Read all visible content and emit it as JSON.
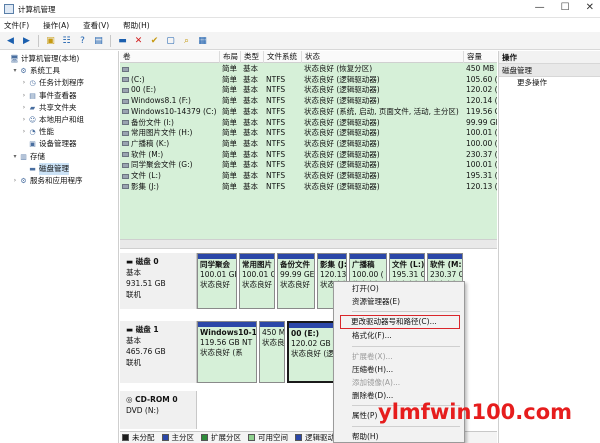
{
  "window": {
    "title": "计算机管理",
    "buttons": [
      "—",
      "☐",
      "✕"
    ]
  },
  "menu": [
    "文件(F)",
    "操作(A)",
    "查看(V)",
    "帮助(H)"
  ],
  "tree": [
    {
      "label": "计算机管理(本地)",
      "indent": 0,
      "expander": "",
      "icon": "computer-icon"
    },
    {
      "label": "系统工具",
      "indent": 1,
      "expander": "▾",
      "icon": "tools-icon"
    },
    {
      "label": "任务计划程序",
      "indent": 2,
      "expander": "›",
      "icon": "clock-icon"
    },
    {
      "label": "事件查看器",
      "indent": 2,
      "expander": "›",
      "icon": "event-icon"
    },
    {
      "label": "共享文件夹",
      "indent": 2,
      "expander": "›",
      "icon": "folder-icon"
    },
    {
      "label": "本地用户和组",
      "indent": 2,
      "expander": "›",
      "icon": "users-icon"
    },
    {
      "label": "性能",
      "indent": 2,
      "expander": "›",
      "icon": "performance-icon"
    },
    {
      "label": "设备管理器",
      "indent": 2,
      "expander": "",
      "icon": "device-icon"
    },
    {
      "label": "存储",
      "indent": 1,
      "expander": "▾",
      "icon": "storage-icon"
    },
    {
      "label": "磁盘管理",
      "indent": 2,
      "expander": "",
      "icon": "disk-icon",
      "selected": true
    },
    {
      "label": "服务和应用程序",
      "indent": 1,
      "expander": "›",
      "icon": "services-icon"
    }
  ],
  "table": {
    "headers": [
      "卷",
      "布局",
      "类型",
      "文件系统",
      "状态",
      "容量"
    ],
    "rows": [
      {
        "vol": "",
        "layout": "简单",
        "type": "基本",
        "fs": "",
        "status": "状态良好 (恢复分区)",
        "cap": "450 MB"
      },
      {
        "vol": "(C:)",
        "layout": "简单",
        "type": "基本",
        "fs": "NTFS",
        "status": "状态良好 (逻辑驱动器)",
        "cap": "105.60 ("
      },
      {
        "vol": "00 (E:)",
        "layout": "简单",
        "type": "基本",
        "fs": "NTFS",
        "status": "状态良好 (逻辑驱动器)",
        "cap": "120.02 ("
      },
      {
        "vol": "Windows8.1 (F:)",
        "layout": "简单",
        "type": "基本",
        "fs": "NTFS",
        "status": "状态良好 (逻辑驱动器)",
        "cap": "120.14 ("
      },
      {
        "vol": "Windows10-14379 (C:)",
        "layout": "简单",
        "type": "基本",
        "fs": "NTFS",
        "status": "状态良好 (系统, 启动, 页面文件, 活动, 主分区)",
        "cap": "119.56 G"
      },
      {
        "vol": "备份文件 (I:)",
        "layout": "简单",
        "type": "基本",
        "fs": "NTFS",
        "status": "状态良好 (逻辑驱动器)",
        "cap": "99.99 GB"
      },
      {
        "vol": "常用图片文件 (H:)",
        "layout": "简单",
        "type": "基本",
        "fs": "NTFS",
        "status": "状态良好 (逻辑驱动器)",
        "cap": "100.01 ("
      },
      {
        "vol": "广播稿 (K:)",
        "layout": "简单",
        "type": "基本",
        "fs": "NTFS",
        "status": "状态良好 (逻辑驱动器)",
        "cap": "100.00 ("
      },
      {
        "vol": "软件 (M:)",
        "layout": "简单",
        "type": "基本",
        "fs": "NTFS",
        "status": "状态良好 (逻辑驱动器)",
        "cap": "230.37 ("
      },
      {
        "vol": "同学聚会文件 (G:)",
        "layout": "简单",
        "type": "基本",
        "fs": "NTFS",
        "status": "状态良好 (逻辑驱动器)",
        "cap": "100.01 ("
      },
      {
        "vol": "文件 (L:)",
        "layout": "简单",
        "type": "基本",
        "fs": "NTFS",
        "status": "状态良好 (逻辑驱动器)",
        "cap": "195.31 ("
      },
      {
        "vol": "影集 (J:)",
        "layout": "简单",
        "type": "基本",
        "fs": "NTFS",
        "status": "状态良好 (逻辑驱动器)",
        "cap": "120.13 ("
      }
    ]
  },
  "disks": [
    {
      "name": "磁盘 0",
      "type": "基本",
      "size": "931.51 GB",
      "state": "联机",
      "partitions": [
        {
          "name": "同学聚会",
          "size": "100.01 GB",
          "status": "状态良好"
        },
        {
          "name": "常用图片",
          "size": "100.01 G",
          "status": "状态良好"
        },
        {
          "name": "备份文件",
          "size": "99.99 GE",
          "status": "状态良好"
        },
        {
          "name": "影集 (J:",
          "size": "120.13 (",
          "status": "状态良好"
        },
        {
          "name": "广播稿",
          "size": "100.00 (",
          "status": "状态良好"
        },
        {
          "name": "文件 (L:)",
          "size": "195.31 G",
          "status": "状态良好"
        },
        {
          "name": "软件 (M:",
          "size": "230.37 G",
          "status": "状态良好"
        }
      ]
    },
    {
      "name": "磁盘 1",
      "type": "基本",
      "size": "465.76 GB",
      "state": "联机",
      "partitions": [
        {
          "name": "Windows10-1",
          "size": "119.56 GB NT",
          "status": "状态良好 (系"
        },
        {
          "name": "",
          "size": "450 M",
          "status": "状态良"
        },
        {
          "name": "00  (E:)",
          "size": "120.02 GB NT",
          "status": "状态良好 (逻"
        }
      ]
    },
    {
      "name": "CD-ROM 0",
      "type": "DVD (N:)",
      "size": "",
      "state": "",
      "partitions": []
    }
  ],
  "legend": [
    {
      "label": "未分配",
      "color": "#1a1a1a"
    },
    {
      "label": "主分区",
      "color": "#2b47a8"
    },
    {
      "label": "扩展分区",
      "color": "#2e8b3a"
    },
    {
      "label": "可用空间",
      "color": "#8fd18f"
    },
    {
      "label": "逻辑驱动器",
      "color": "#2b47a8"
    }
  ],
  "actions": {
    "header": "操作",
    "section": "磁盘管理",
    "items": [
      "更多操作"
    ]
  },
  "context_menu": [
    {
      "label": "打开(O)",
      "enabled": true
    },
    {
      "label": "资源管理器(E)",
      "enabled": true
    },
    {
      "sep": true
    },
    {
      "label": "更改驱动器号和路径(C)...",
      "enabled": true,
      "highlight": true
    },
    {
      "label": "格式化(F)...",
      "enabled": true
    },
    {
      "sep": true
    },
    {
      "label": "扩展卷(X)...",
      "enabled": false
    },
    {
      "label": "压缩卷(H)...",
      "enabled": true
    },
    {
      "label": "添加镜像(A)...",
      "enabled": false
    },
    {
      "label": "删除卷(D)...",
      "enabled": true
    },
    {
      "sep": true
    },
    {
      "label": "属性(P)",
      "enabled": true
    },
    {
      "sep": true
    },
    {
      "label": "帮助(H)",
      "enabled": true
    }
  ],
  "watermark": "ylmfwin100.com"
}
